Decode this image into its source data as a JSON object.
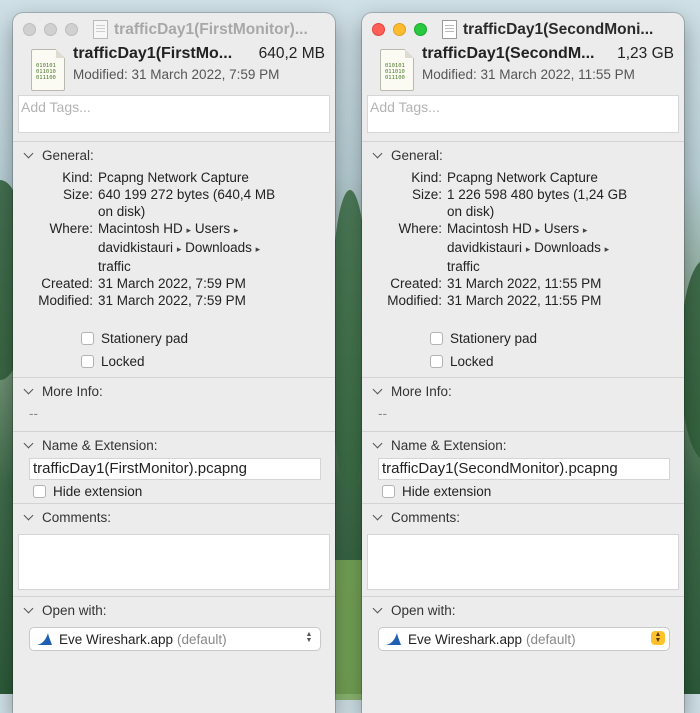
{
  "windows": [
    {
      "title": "trafficDay1(FirstMonitor)...",
      "name": "trafficDay1(FirstMo...",
      "size": "640,2 MB",
      "modified_header": "Modified: 31 March 2022, 7:59 PM",
      "tags_placeholder": "Add Tags...",
      "general": {
        "label": "General:",
        "kind_k": "Kind:",
        "kind": "Pcapng Network Capture",
        "size_k": "Size:",
        "size1": "640 199 272 bytes (640,4 MB",
        "size2": "on disk)",
        "where_k": "Where:",
        "where1a": "Macintosh HD",
        "where1b": "Users",
        "where2a": "davidkistauri",
        "where2b": "Downloads",
        "where3": "traffic",
        "created_k": "Created:",
        "created": "31 March 2022, 7:59 PM",
        "modified_k": "Modified:",
        "modified": "31 March 2022, 7:59 PM",
        "stationery": "Stationery pad",
        "locked": "Locked"
      },
      "more_info": {
        "label": "More Info:",
        "value": "--"
      },
      "name_ext": {
        "label": "Name & Extension:",
        "value": "trafficDay1(FirstMonitor).pcapng",
        "hide": "Hide extension"
      },
      "comments": {
        "label": "Comments:"
      },
      "open_with": {
        "label": "Open with:",
        "app": "Eve Wireshark.app",
        "def": "(default)"
      }
    },
    {
      "title": "trafficDay1(SecondMoni...",
      "name": "trafficDay1(SecondM...",
      "size": "1,23 GB",
      "modified_header": "Modified: 31 March 2022, 11:55 PM",
      "tags_placeholder": "Add Tags...",
      "general": {
        "label": "General:",
        "kind_k": "Kind:",
        "kind": "Pcapng Network Capture",
        "size_k": "Size:",
        "size1": "1 226 598 480 bytes (1,24 GB",
        "size2": "on disk)",
        "where_k": "Where:",
        "where1a": "Macintosh HD",
        "where1b": "Users",
        "where2a": "davidkistauri",
        "where2b": "Downloads",
        "where3": "traffic",
        "created_k": "Created:",
        "created": "31 March 2022, 11:55 PM",
        "modified_k": "Modified:",
        "modified": "31 March 2022, 11:55 PM",
        "stationery": "Stationery pad",
        "locked": "Locked"
      },
      "more_info": {
        "label": "More Info:",
        "value": "--"
      },
      "name_ext": {
        "label": "Name & Extension:",
        "value": "trafficDay1(SecondMonitor).pcapng",
        "hide": "Hide extension"
      },
      "comments": {
        "label": "Comments:"
      },
      "open_with": {
        "label": "Open with:",
        "app": "Eve Wireshark.app",
        "def": "(default)"
      }
    }
  ],
  "icon_text": [
    "010101",
    "011010",
    "011100"
  ],
  "colors": {
    "close": "#ff5f57",
    "minimize": "#febc2e",
    "maximize": "#28c840",
    "stepper_active": "#ffc22c"
  }
}
